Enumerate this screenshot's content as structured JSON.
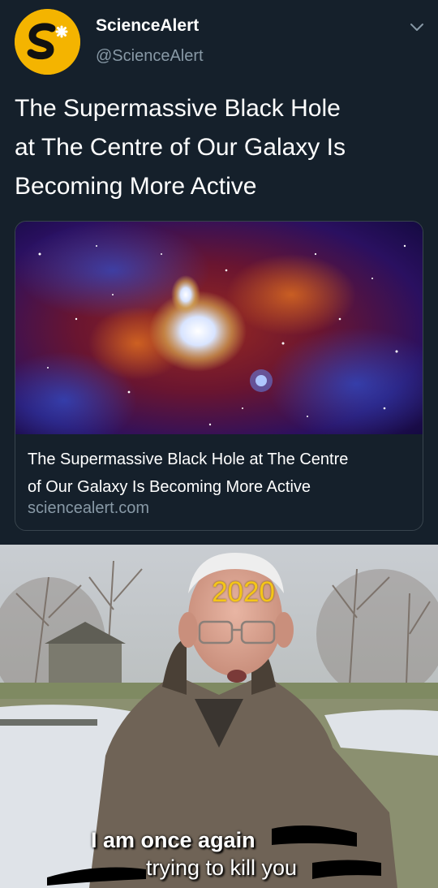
{
  "tweet": {
    "author_name": "ScienceAlert",
    "author_handle": "@ScienceAlert",
    "avatar_icon": "sciencealert-logo",
    "menu_icon": "chevron-down-icon",
    "text_lines": [
      "The Supermassive Black Hole",
      "at The Centre of Our Galaxy Is",
      "Becoming More Active"
    ],
    "card": {
      "title_lines": [
        "The Supermassive Black Hole at The Centre",
        "of Our Galaxy Is Becoming More Active"
      ],
      "domain": "sciencealert.com"
    }
  },
  "meme": {
    "label": "2020",
    "caption_line1": "I am once again",
    "caption_line2": "trying to kill you"
  },
  "colors": {
    "background": "#15202b",
    "secondary_text": "#8899a6",
    "border": "#38444d",
    "logo_yellow": "#f4b400",
    "label_yellow": "#f5c518"
  }
}
